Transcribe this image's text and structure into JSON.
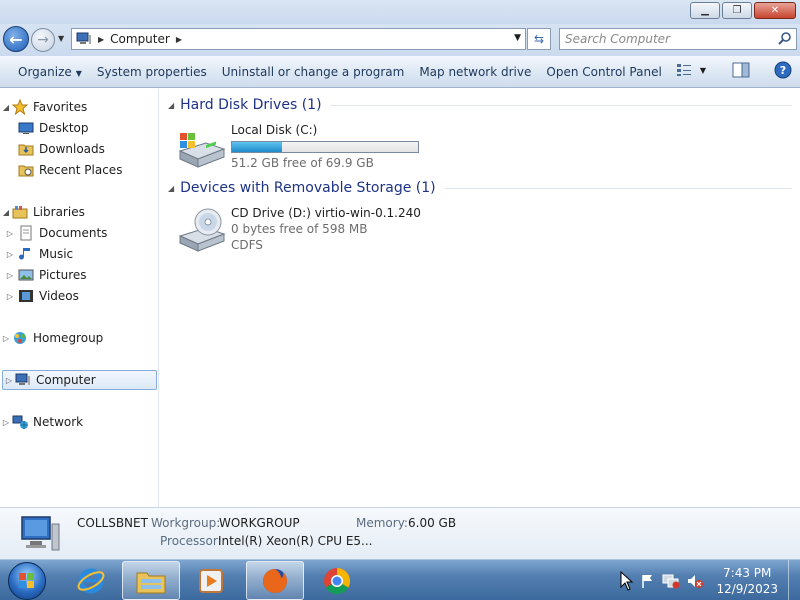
{
  "address": {
    "location": "Computer"
  },
  "search": {
    "placeholder": "Search Computer"
  },
  "commands": {
    "organize": "Organize",
    "system_properties": "System properties",
    "uninstall": "Uninstall or change a program",
    "map_drive": "Map network drive",
    "control_panel": "Open Control Panel"
  },
  "nav": {
    "favorites": "Favorites",
    "desktop": "Desktop",
    "downloads": "Downloads",
    "recent_places": "Recent Places",
    "libraries": "Libraries",
    "documents": "Documents",
    "music": "Music",
    "pictures": "Pictures",
    "videos": "Videos",
    "homegroup": "Homegroup",
    "computer": "Computer",
    "network": "Network"
  },
  "groups": {
    "hdd": "Hard Disk Drives (1)",
    "removable": "Devices with Removable Storage (1)"
  },
  "drives": {
    "local": {
      "name": "Local Disk (C:)",
      "free": "51.2 GB free of 69.9 GB",
      "used_fraction": 0.2675
    },
    "cd": {
      "name": "CD Drive (D:) virtio-win-0.1.240",
      "free": "0 bytes free of 598 MB",
      "fs": "CDFS"
    }
  },
  "details": {
    "computer_name": "COLLSBNET",
    "workgroup_label": "Workgroup:",
    "workgroup": "WORKGROUP",
    "memory_label": "Memory:",
    "memory": "6.00 GB",
    "processor_label": "Processor:",
    "processor": "Intel(R) Xeon(R) CPU E5..."
  },
  "clock": {
    "time": "7:43 PM",
    "date": "12/9/2023"
  },
  "colors": {
    "accent": "#1e3287",
    "selection_border": "#84acdd",
    "bar_fill": "#1e8ac8"
  }
}
